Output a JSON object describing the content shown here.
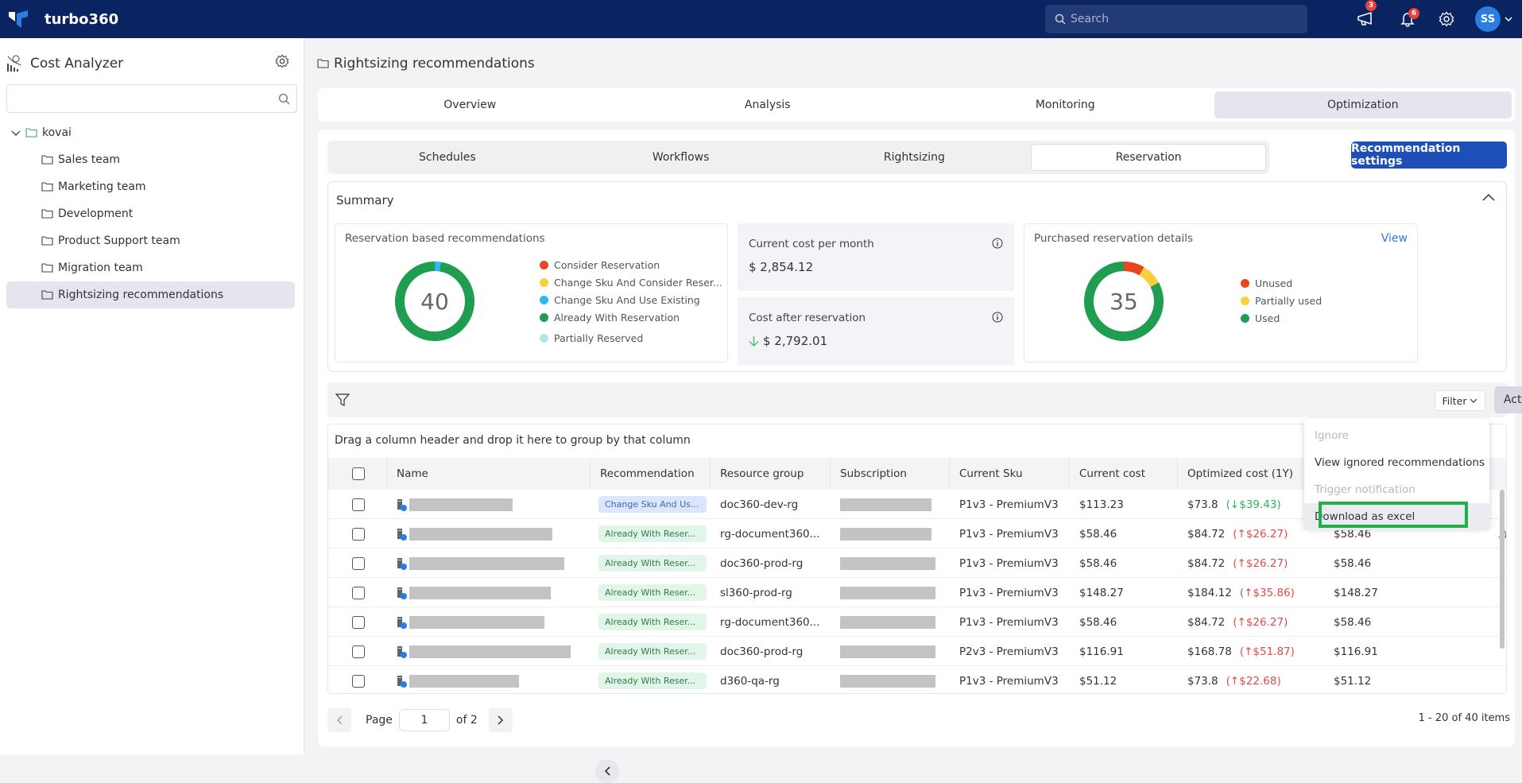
{
  "app": {
    "name": "turbo360"
  },
  "header": {
    "search_placeholder": "Search",
    "announcements_badge": "3",
    "notifications_badge": "6",
    "user_initials": "SS"
  },
  "sidebar": {
    "title": "Cost Analyzer",
    "search_placeholder": "",
    "root": "kovai",
    "items": [
      {
        "label": "Sales team"
      },
      {
        "label": "Marketing team"
      },
      {
        "label": "Development"
      },
      {
        "label": "Product Support team"
      },
      {
        "label": "Migration team"
      },
      {
        "label": "Rightsizing recommendations",
        "selected": true
      }
    ]
  },
  "page": {
    "title": "Rightsizing recommendations",
    "main_tabs": [
      {
        "label": "Overview"
      },
      {
        "label": "Analysis"
      },
      {
        "label": "Monitoring"
      },
      {
        "label": "Optimization",
        "active": true
      }
    ],
    "sub_tabs": [
      {
        "label": "Schedules"
      },
      {
        "label": "Workflows"
      },
      {
        "label": "Rightsizing"
      },
      {
        "label": "Reservation",
        "active": true
      }
    ],
    "recommendation_settings_label": "Recommendation settings"
  },
  "summary": {
    "title": "Summary",
    "reservation_recs": {
      "title": "Reservation based recommendations",
      "total": "40",
      "legend": [
        {
          "label": "Consider Reservation",
          "color": "#e8461e",
          "value": 0
        },
        {
          "label": "Change Sku And Consider Reser...",
          "color": "#fbd03c",
          "value": 0
        },
        {
          "label": "Change Sku And Use Existing",
          "color": "#2bb8ee",
          "value": 1
        },
        {
          "label": "Already With Reservation",
          "color": "#1f9d50",
          "value": 39
        },
        {
          "label": "Partially Reserved",
          "color": "#b5e8ec",
          "value": 0
        }
      ]
    },
    "current_cost": {
      "label": "Current cost per month",
      "value": "$ 2,854.12"
    },
    "cost_after": {
      "label": "Cost after reservation",
      "value": "$ 2,792.01"
    },
    "purchased": {
      "title": "Purchased reservation details",
      "view_label": "View",
      "total": "35",
      "legend": [
        {
          "label": "Unused",
          "color": "#e8461e",
          "value": 3
        },
        {
          "label": "Partially used",
          "color": "#fbd03c",
          "value": 3
        },
        {
          "label": "Used",
          "color": "#1f9d50",
          "value": 29
        }
      ]
    }
  },
  "toolbar": {
    "filter_label": "Filter",
    "actions_label": "Actions"
  },
  "actions_menu": [
    {
      "label": "Ignore",
      "disabled": true
    },
    {
      "label": "View ignored recommendations",
      "disabled": false
    },
    {
      "label": "Trigger notification",
      "disabled": true
    },
    {
      "label": "Download as excel",
      "disabled": false,
      "highlighted": true
    }
  ],
  "grid": {
    "group_hint": "Drag a column header and drop it here to group by that column",
    "columns": [
      "Name",
      "Recommendation",
      "Resource group",
      "Subscription",
      "Current Sku",
      "Current cost",
      "Optimized cost (1Y)",
      ""
    ],
    "rows": [
      {
        "recommendation": "Change Sku And Us...",
        "rec_type": "blue",
        "resource_group": "doc360-dev-rg",
        "sku": "P1v3 - PremiumV3",
        "current_cost": "$113.23",
        "optimized": "$73.8",
        "delta": "(↓$39.43)",
        "delta_dir": "down",
        "last": ""
      },
      {
        "recommendation": "Already With Reser...",
        "rec_type": "green",
        "resource_group": "rg-document360...",
        "sku": "P1v3 - PremiumV3",
        "current_cost": "$58.46",
        "optimized": "$84.72",
        "delta": "(↑$26.27)",
        "delta_dir": "up",
        "last": "$58.46"
      },
      {
        "recommendation": "Already With Reser...",
        "rec_type": "green",
        "resource_group": "doc360-prod-rg",
        "sku": "P1v3 - PremiumV3",
        "current_cost": "$58.46",
        "optimized": "$84.72",
        "delta": "(↑$26.27)",
        "delta_dir": "up",
        "last": "$58.46"
      },
      {
        "recommendation": "Already With Reser...",
        "rec_type": "green",
        "resource_group": "sl360-prod-rg",
        "sku": "P1v3 - PremiumV3",
        "current_cost": "$148.27",
        "optimized": "$184.12",
        "delta": "(↑$35.86)",
        "delta_dir": "up",
        "last": "$148.27"
      },
      {
        "recommendation": "Already With Reser...",
        "rec_type": "green",
        "resource_group": "rg-document360...",
        "sku": "P1v3 - PremiumV3",
        "current_cost": "$58.46",
        "optimized": "$84.72",
        "delta": "(↑$26.27)",
        "delta_dir": "up",
        "last": "$58.46"
      },
      {
        "recommendation": "Already With Reser...",
        "rec_type": "green",
        "resource_group": "doc360-prod-rg",
        "sku": "P2v3 - PremiumV3",
        "current_cost": "$116.91",
        "optimized": "$168.78",
        "delta": "(↑$51.87)",
        "delta_dir": "up",
        "last": "$116.91"
      },
      {
        "recommendation": "Already With Reser...",
        "rec_type": "green",
        "resource_group": "d360-qa-rg",
        "sku": "P1v3 - PremiumV3",
        "current_cost": "$51.12",
        "optimized": "$73.8",
        "delta": "(↑$22.68)",
        "delta_dir": "up",
        "last": "$51.12"
      }
    ]
  },
  "pager": {
    "page_label": "Page",
    "current_page": "1",
    "of_label": "of 2",
    "items_summary": "1 - 20 of 40 items"
  }
}
